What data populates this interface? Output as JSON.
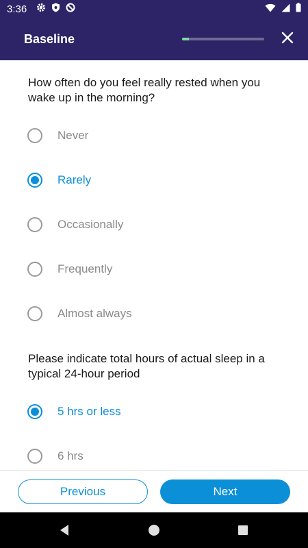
{
  "status_bar": {
    "time": "3:36",
    "icons_left": [
      "gear-icon",
      "shield-icon",
      "no-disturb-icon"
    ],
    "icons_right": [
      "wifi-icon",
      "signal-icon",
      "battery-icon"
    ]
  },
  "app_bar": {
    "title": "Baseline",
    "progress": 0.08,
    "close_icon": "close-icon"
  },
  "questions": [
    {
      "text": "How often do you feel really rested when you wake up in the morning?",
      "options": [
        "Never",
        "Rarely",
        "Occasionally",
        "Frequently",
        "Almost always"
      ],
      "selected_index": 1
    },
    {
      "text": "Please indicate total hours of actual sleep in a typical 24-hour period",
      "options": [
        "5 hrs or less",
        "6 hrs"
      ],
      "selected_index": 0
    }
  ],
  "footer": {
    "previous_label": "Previous",
    "next_label": "Next"
  },
  "nav_bar": {
    "icons": [
      "back-icon",
      "home-icon",
      "recents-icon"
    ]
  },
  "colors": {
    "header_bg": "#2c2466",
    "accent": "#0b8fd6",
    "progress_fill": "#7ddc9f"
  }
}
